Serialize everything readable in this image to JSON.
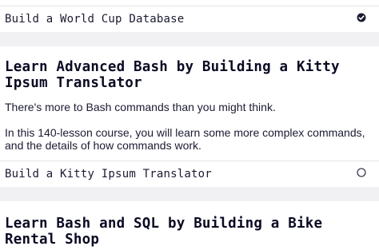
{
  "projects": [
    {
      "label": "Build a World Cup Database",
      "status_icon": "check-circle-icon"
    }
  ],
  "courses": [
    {
      "title": "Learn Advanced Bash by Building a Kitty Ipsum Translator",
      "paragraph_1": "There's more to Bash commands than you might think.",
      "paragraph_2": "In this 140-lesson course, you will learn some more complex commands, and the details of how commands work.",
      "project_label": "Build a Kitty Ipsum Translator",
      "project_status_icon": "empty-circle-icon"
    },
    {
      "title": "Learn Bash and SQL by Building a Bike Rental Shop"
    }
  ],
  "colors": {
    "text": "#1b1b32",
    "heading": "#0a0a23",
    "divider": "#e6e6ea",
    "section_gap": "#f1f1f3"
  }
}
